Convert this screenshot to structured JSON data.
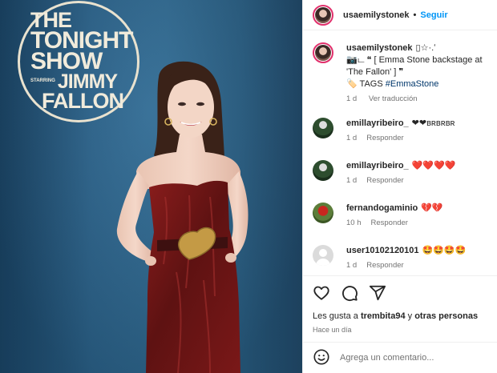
{
  "header": {
    "username": "usaemilystonek",
    "separator": "•",
    "follow_label": "Seguir"
  },
  "photo": {
    "logo_line1": "THE",
    "logo_line2": "TONIGHT",
    "logo_line3": "SHOW",
    "logo_starring": "STARRING",
    "logo_jimmy": "JIMMY",
    "logo_fallon": "FALLON"
  },
  "caption": {
    "username": "usaemilystonek",
    "line1": "▯☆·.ʻ",
    "line2": "📷ட ❝ [ Emma Stone backstage at 'The Fallon' ] ❞",
    "tags_label": "🏷️ TAGS",
    "hashtag": "#EmmaStone",
    "time": "1 d",
    "translate": "Ver traducción"
  },
  "comments": [
    {
      "username": "emillayribeiro_",
      "text": "❤❤ʙʀʙʀʙʀ",
      "time": "1 d",
      "reply": "Responder"
    },
    {
      "username": "emillayribeiro_",
      "text": "❤️❤️❤️❤️",
      "time": "1 d",
      "reply": "Responder"
    },
    {
      "username": "fernandogaminio",
      "text": "💔💔",
      "time": "10 h",
      "reply": "Responder"
    },
    {
      "username": "user10102120101",
      "text": "🤩🤩🤩🤩",
      "time": "1 d",
      "reply": "Responder"
    }
  ],
  "actions": {
    "likes_prefix": "Les gusta a",
    "likes_user": "trembita94",
    "likes_connector": "y",
    "likes_others": "otras personas",
    "posted_ago": "Hace un día"
  },
  "add_comment": {
    "placeholder": "Agrega un comentario..."
  },
  "colors": {
    "accent": "#0095f6",
    "hashtag": "#00376b",
    "secondary_text": "#737373",
    "photo_backdrop": "#2c6690",
    "dress": "#6e1414"
  },
  "icons": [
    "heart-icon",
    "comment-icon",
    "share-icon",
    "emoji-icon",
    "person-icon"
  ]
}
